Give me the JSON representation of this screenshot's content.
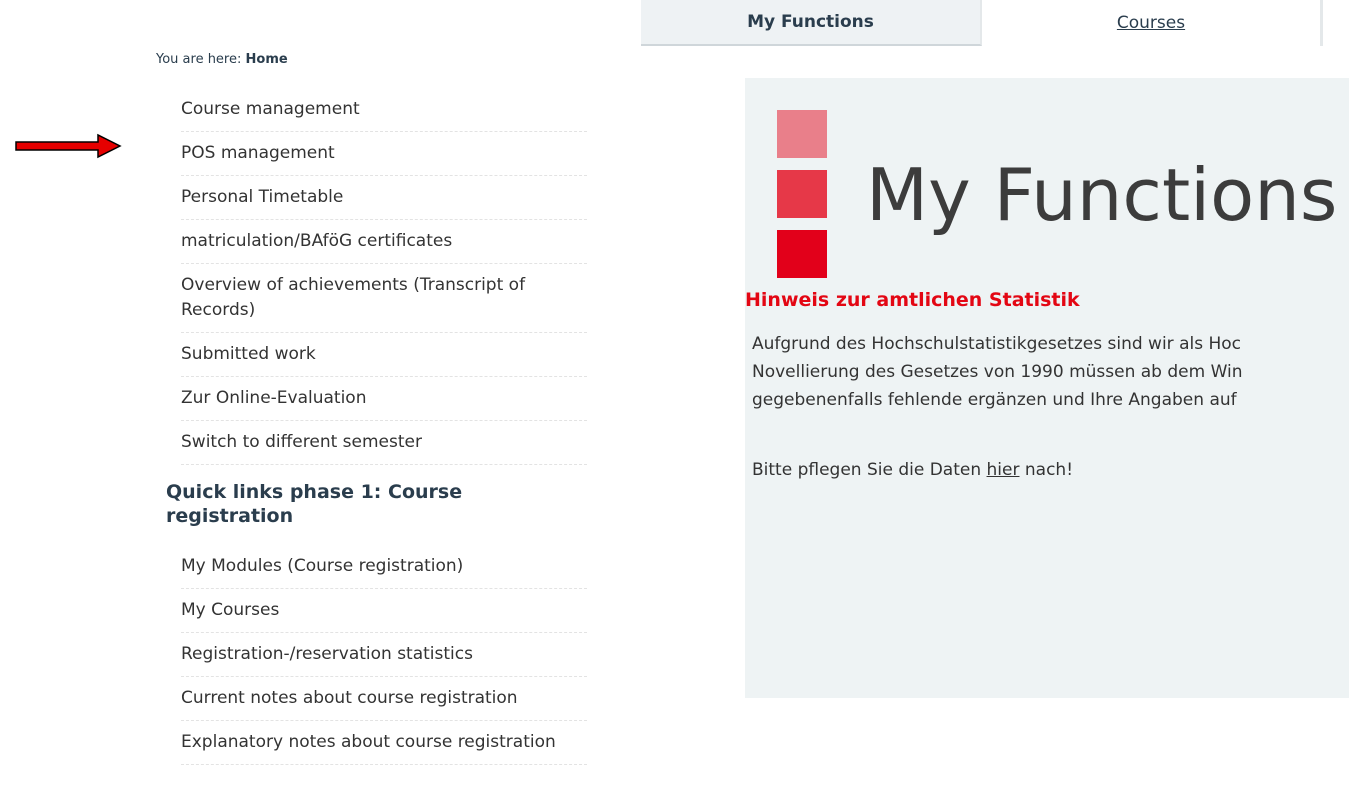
{
  "tabs": {
    "my_functions": "My Functions",
    "courses": "Courses"
  },
  "breadcrumb": {
    "prefix": "You are here: ",
    "current": "Home"
  },
  "sidebar": {
    "items": [
      "Course management",
      "POS management",
      "Personal Timetable",
      "matriculation/BAföG certificates",
      "Overview of achievements (Transcript of Records)",
      "Submitted work",
      "Zur Online-Evaluation",
      "Switch to different semester"
    ],
    "quicklinks_heading": "Quick links phase 1: Course registration",
    "quicklinks": [
      "My Modules (Course registration)",
      "My Courses",
      "Registration-/reservation statistics",
      "Current notes about course registration",
      "Explanatory notes about course registration"
    ]
  },
  "main": {
    "title": "My Functions",
    "notice_title": "Hinweis zur amtlichen Statistik",
    "notice_lines": [
      "Aufgrund des Hochschulstatistikgesetzes sind wir als Hoc",
      "Novellierung des Gesetzes von 1990 müssen ab dem Win",
      "gegebenenfalls fehlende ergänzen und Ihre Angaben auf"
    ],
    "cta_before": "Bitte pflegen Sie die Daten ",
    "cta_link": "hier",
    "cta_after": " nach!"
  },
  "colors": {
    "accent_red": "#e30613",
    "bar_light": "#e97f8a",
    "bar_mid": "#e63848",
    "bar_dark": "#e2001a",
    "arrow": "#e60000"
  }
}
